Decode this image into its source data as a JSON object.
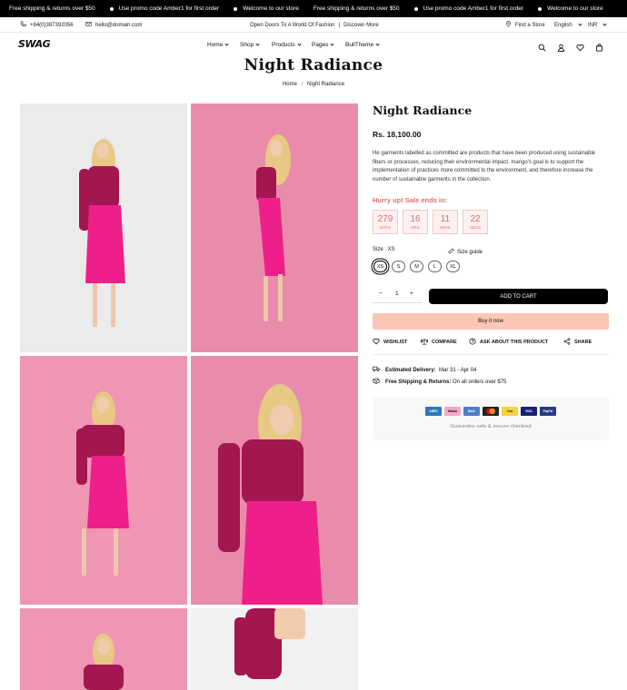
{
  "announcement_bar": {
    "messages": [
      "Free shipping & returns over $50",
      "Use promo code Amber1 for first order",
      "Welcome to our store",
      "Free shipping & returns over $50",
      "Use promo code Amber1 for first order",
      "Welcome to our store"
    ]
  },
  "utility_bar": {
    "phone": "+84(0)387392056",
    "email": "hello@domain.com",
    "promo_text": "Open Doors To A World Of Fashion",
    "promo_link": "Discover More",
    "separator": "|",
    "find_store": "Find a Store",
    "language": "English",
    "currency": "INR"
  },
  "header": {
    "logo": "SWAG",
    "nav": [
      "Home",
      "Shop",
      "Products",
      "Pages",
      "BullTheme"
    ]
  },
  "page": {
    "title": "Night Radiance",
    "breadcrumb": {
      "home": "Home",
      "separator": "/",
      "current": "Night Radiance"
    }
  },
  "product": {
    "title": "Night Radiance",
    "price": "Rs. 18,100.00",
    "description": "He garments labelled as committed are products that have been produced using sustainable fibers or processes, reducing their environmental impact. mango's goal is to support the implementation of practices more committed to the environment, and therefore increase the number of sustainable garments in the collection.",
    "sale_heading": "Hurry up! Sale ends in:",
    "countdown": [
      {
        "value": "279",
        "label": "DAYS"
      },
      {
        "value": "16",
        "label": "HRS"
      },
      {
        "value": "11",
        "label": "MINS"
      },
      {
        "value": "22",
        "label": "SECS"
      }
    ],
    "size_label": "Size : XS",
    "size_guide": "Size guide",
    "sizes": [
      "XS",
      "S",
      "M",
      "L",
      "XL"
    ],
    "selected_size": "XS",
    "quantity": "1",
    "qty_minus": "−",
    "qty_plus": "+",
    "add_to_cart": "ADD TO CART",
    "buy_now": "Buy it now",
    "actions": [
      "WISHLIST",
      "COMPARE",
      "ASK ABOUT THIS PRODUCT",
      "SHARE"
    ],
    "delivery_label": "Estimated Delivery:",
    "delivery_value": "Mar 31 - Apr 04",
    "shipping_label": "Free Shipping & Returns:",
    "shipping_value": "On all orders over $75",
    "payment_methods": [
      "AMEX",
      "Klarna",
      "Bank",
      "Mastercard",
      "Visa",
      "VISA",
      "PayPal"
    ],
    "secure_text": "Guarantee safe & secure checkout"
  },
  "colors": {
    "accent_black": "#000000",
    "sale_red": "#e56b6b",
    "buy_now_bg": "#fac7b6",
    "dress_pink": "#ee1f8a",
    "sequin_top": "#a3164f",
    "backdrop_pink": "#e98cab"
  }
}
